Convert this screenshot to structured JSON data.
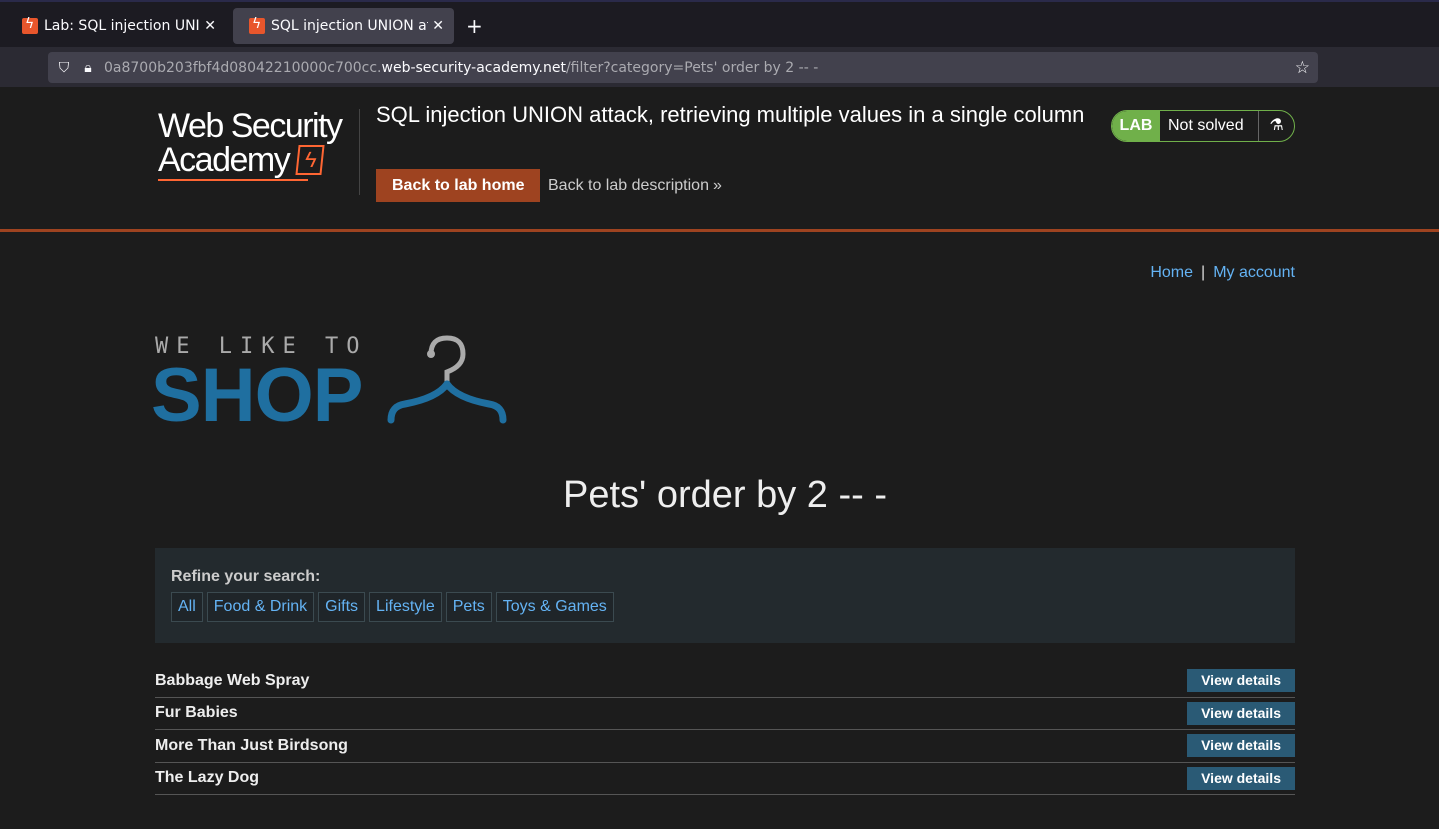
{
  "browser": {
    "tabs": [
      {
        "label": "Lab: SQL injection UNION"
      },
      {
        "label": "SQL injection UNION atta"
      }
    ],
    "url": {
      "prefix": "0a8700b203fbf4d08042210000c700cc.",
      "host": "web-security-academy.net",
      "path": "/filter?category=Pets' order by 2 -- -"
    }
  },
  "lab_header": {
    "logo_line1": "Web Security",
    "logo_line2": "Academy",
    "title": "SQL injection UNION attack, retrieving multiple values in a single column",
    "back_home": "Back to lab home",
    "back_description": "Back to lab description",
    "status_badge": "LAB",
    "status_text": "Not solved"
  },
  "nav": {
    "home": "Home",
    "separator": "|",
    "account": "My account"
  },
  "shop_logo": {
    "small": "WE LIKE TO",
    "big": "SHOP"
  },
  "category_title": "Pets' order by 2 -- -",
  "refine": {
    "label": "Refine your search:",
    "filters": [
      "All",
      "Food & Drink",
      "Gifts",
      "Lifestyle",
      "Pets",
      "Toys & Games"
    ]
  },
  "products": [
    {
      "name": "Babbage Web Spray",
      "button": "View details"
    },
    {
      "name": "Fur Babies",
      "button": "View details"
    },
    {
      "name": "More Than Just Birdsong",
      "button": "View details"
    },
    {
      "name": "The Lazy Dog",
      "button": "View details"
    }
  ],
  "colors": {
    "accent": "#9e4320",
    "link": "#64b3f4",
    "shop_blue": "#1f6fa0",
    "status_green": "#70b04a"
  }
}
